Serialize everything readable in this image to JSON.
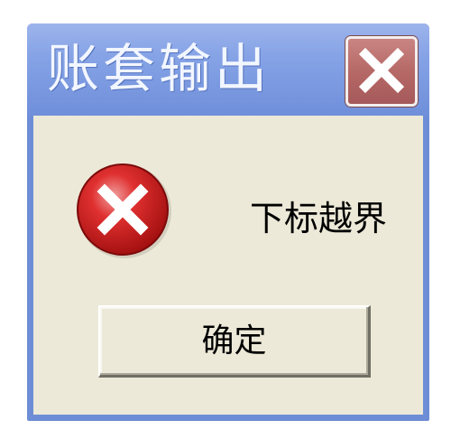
{
  "window": {
    "title": "账套输出"
  },
  "titlebar": {
    "close_icon": "close-icon",
    "close_color": "#b66966"
  },
  "dialog": {
    "icon": "error-icon",
    "icon_color": "#cc1f1f",
    "message": "下标越界",
    "ok_label": "确定"
  },
  "colors": {
    "titlebar": "#7f9de2",
    "body": "#ece9d8"
  }
}
